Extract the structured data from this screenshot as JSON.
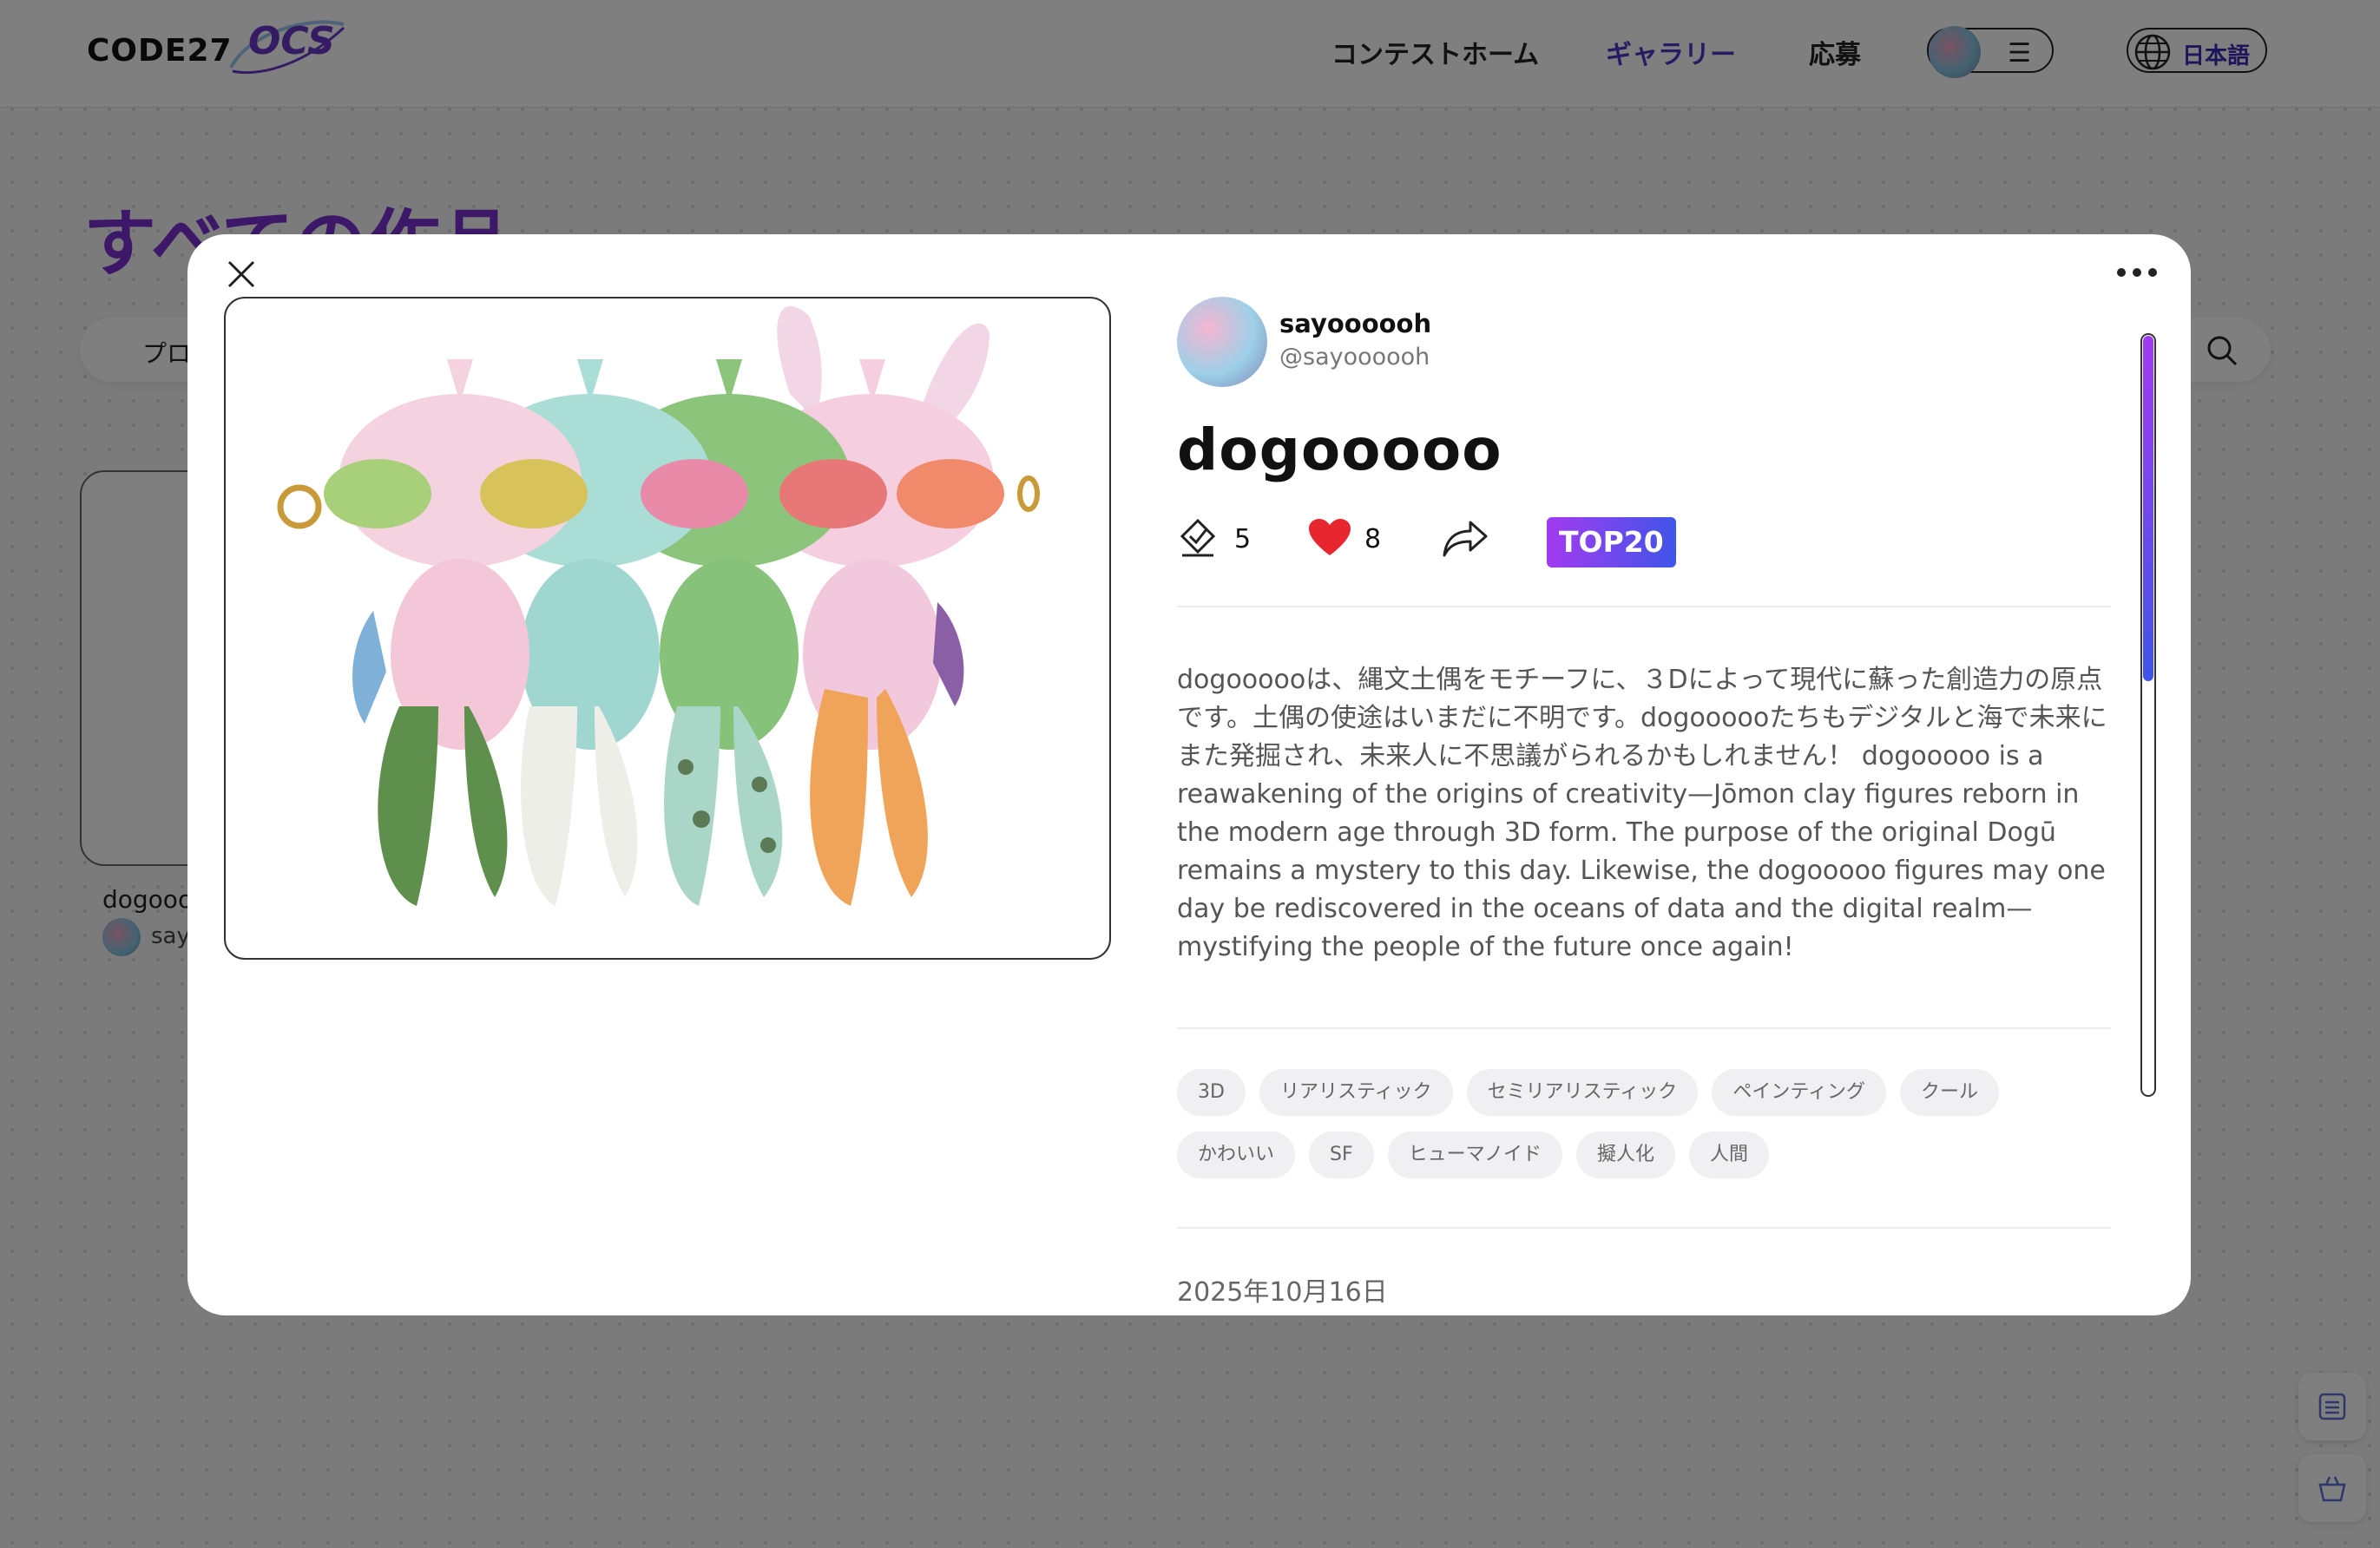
{
  "header": {
    "logo_code": "CODE27",
    "logo_ocs": "OCS",
    "nav": [
      {
        "label": "コンテストホーム"
      },
      {
        "label": "ギャラリー"
      },
      {
        "label": "応募"
      }
    ],
    "language": "日本語"
  },
  "page": {
    "title": "すべての作品",
    "search_prefix": "プロ",
    "card_title": "dogooo",
    "card_user": "say"
  },
  "modal": {
    "author": {
      "name": "sayoooooh",
      "handle": "@sayoooooh"
    },
    "title": "dogooooo",
    "stats": {
      "evaluations": "5",
      "likes": "8"
    },
    "badge": "TOP20",
    "description": "dogoooooは、縄文土偶をモチーフに、３Dによって現代に蘇った創造力の原点です。土偶の使途はいまだに不明です。dogoooooたちもデジタルと海で未来にまた発掘され、未来人に不思議がられるかもしれません！ dogooooo is a reawakening of the origins of creativity—Jōmon clay figures reborn in the modern age through 3D form. The purpose of the original Dogū remains a mystery to this day. Likewise, the dogooooo figures may one day be rediscovered in the oceans of data and the digital realm—mystifying the people of the future once again!",
    "tags": [
      "3D",
      "リアリスティック",
      "セミリアリスティック",
      "ペインティング",
      "クール",
      "かわいい",
      "SF",
      "ヒューマノイド",
      "擬人化",
      "人間"
    ],
    "date": "2025年10月16日"
  },
  "colors": {
    "accent": "#4a3bc9",
    "title_purple": "#7b2fd1",
    "badge_gradient_start": "#a33bf0",
    "badge_gradient_end": "#3f55e8",
    "like_red": "#e8262f"
  }
}
